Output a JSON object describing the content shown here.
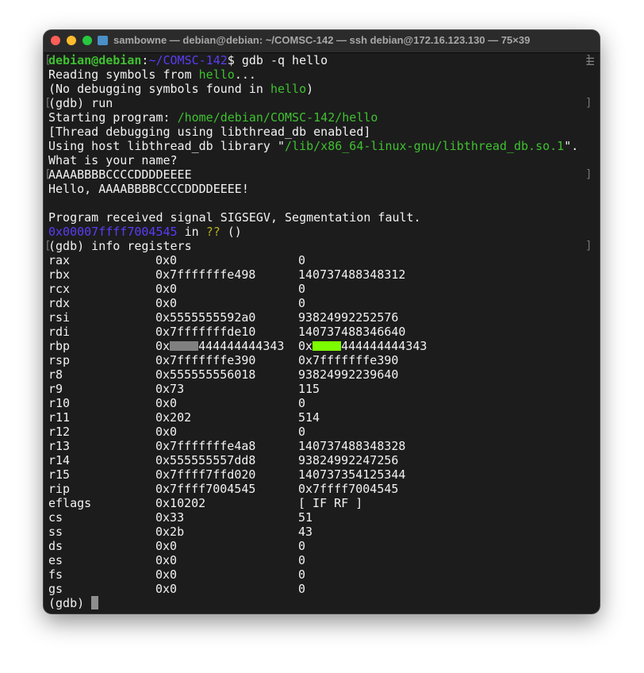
{
  "window": {
    "title": "sambowne — debian@debian: ~/COMSC-142 — ssh debian@172.16.123.130 — 75×39"
  },
  "colors": {
    "green": "#3fc130",
    "blue": "#5b3cf5",
    "yellow": "#b8b01e",
    "text": "#f2f2f2",
    "background": "#1c1c1c",
    "highlight_gray": "#808080",
    "highlight_lime": "#7cfc00"
  },
  "terminal": {
    "lines": [
      {
        "mark": true,
        "segs": [
          {
            "t": "debian@debian",
            "c": "pg"
          },
          {
            "t": ":",
            "c": "w"
          },
          {
            "t": "~/COMSC-142",
            "c": "b"
          },
          {
            "t": "$ gdb -q hello",
            "c": "w"
          }
        ]
      },
      {
        "segs": [
          {
            "t": "Reading symbols from ",
            "c": "w"
          },
          {
            "t": "hello",
            "c": "g"
          },
          {
            "t": "...",
            "c": "w"
          }
        ]
      },
      {
        "segs": [
          {
            "t": "(No debugging symbols found in ",
            "c": "w"
          },
          {
            "t": "hello",
            "c": "g"
          },
          {
            "t": ")",
            "c": "w"
          }
        ]
      },
      {
        "mark": true,
        "segs": [
          {
            "t": "(gdb) run",
            "c": "w"
          }
        ]
      },
      {
        "segs": [
          {
            "t": "Starting program: ",
            "c": "w"
          },
          {
            "t": "/home/debian/COMSC-142/hello",
            "c": "g"
          }
        ]
      },
      {
        "segs": [
          {
            "t": "[Thread debugging using libthread_db enabled]",
            "c": "w"
          }
        ]
      },
      {
        "segs": [
          {
            "t": "Using host libthread_db library \"",
            "c": "w"
          },
          {
            "t": "/lib/x86_64-linux-gnu/libthread_db.so.1",
            "c": "g"
          },
          {
            "t": "\".",
            "c": "w"
          }
        ]
      },
      {
        "segs": [
          {
            "t": "What is your name?",
            "c": "w"
          }
        ]
      },
      {
        "mark": true,
        "segs": [
          {
            "t": "AAAABBBBCCCCDDDDEEEE",
            "c": "w"
          }
        ]
      },
      {
        "segs": [
          {
            "t": "Hello, AAAABBBBCCCCDDDDEEEE!",
            "c": "w"
          }
        ]
      },
      {
        "segs": []
      },
      {
        "segs": [
          {
            "t": "Program received signal SIGSEGV, Segmentation fault.",
            "c": "w"
          }
        ]
      },
      {
        "segs": [
          {
            "t": "0x00007ffff7004545",
            "c": "b"
          },
          {
            "t": " in ",
            "c": "w"
          },
          {
            "t": "??",
            "c": "y"
          },
          {
            "t": " ()",
            "c": "w"
          }
        ]
      },
      {
        "mark": true,
        "segs": [
          {
            "t": "(gdb) info registers",
            "c": "w"
          }
        ]
      }
    ],
    "registers": [
      {
        "name": "rax",
        "hex": "0x0",
        "dec": "0"
      },
      {
        "name": "rbx",
        "hex": "0x7fffffffe498",
        "dec": "140737488348312"
      },
      {
        "name": "rcx",
        "hex": "0x0",
        "dec": "0"
      },
      {
        "name": "rdx",
        "hex": "0x0",
        "dec": "0"
      },
      {
        "name": "rsi",
        "hex": "0x5555555592a0",
        "dec": "93824992252576"
      },
      {
        "name": "rdi",
        "hex": "0x7fffffffde10",
        "dec": "140737488346640"
      },
      {
        "name": "rbp",
        "hex_prefix": "0x",
        "hex_suffix": "444444444343",
        "dec_prefix": "0x",
        "dec_suffix": "444444444343",
        "redacted": true
      },
      {
        "name": "rsp",
        "hex": "0x7fffffffe390",
        "dec": "0x7fffffffe390"
      },
      {
        "name": "r8",
        "hex": "0x555555556018",
        "dec": "93824992239640"
      },
      {
        "name": "r9",
        "hex": "0x73",
        "dec": "115"
      },
      {
        "name": "r10",
        "hex": "0x0",
        "dec": "0"
      },
      {
        "name": "r11",
        "hex": "0x202",
        "dec": "514"
      },
      {
        "name": "r12",
        "hex": "0x0",
        "dec": "0"
      },
      {
        "name": "r13",
        "hex": "0x7fffffffe4a8",
        "dec": "140737488348328"
      },
      {
        "name": "r14",
        "hex": "0x555555557dd8",
        "dec": "93824992247256"
      },
      {
        "name": "r15",
        "hex": "0x7ffff7ffd020",
        "dec": "140737354125344"
      },
      {
        "name": "rip",
        "hex": "0x7ffff7004545",
        "dec": "0x7ffff7004545"
      },
      {
        "name": "eflags",
        "hex": "0x10202",
        "dec": "[ IF RF ]"
      },
      {
        "name": "cs",
        "hex": "0x33",
        "dec": "51"
      },
      {
        "name": "ss",
        "hex": "0x2b",
        "dec": "43"
      },
      {
        "name": "ds",
        "hex": "0x0",
        "dec": "0"
      },
      {
        "name": "es",
        "hex": "0x0",
        "dec": "0"
      },
      {
        "name": "fs",
        "hex": "0x0",
        "dec": "0"
      },
      {
        "name": "gs",
        "hex": "0x0",
        "dec": "0"
      }
    ],
    "final_prompt": "(gdb) "
  }
}
